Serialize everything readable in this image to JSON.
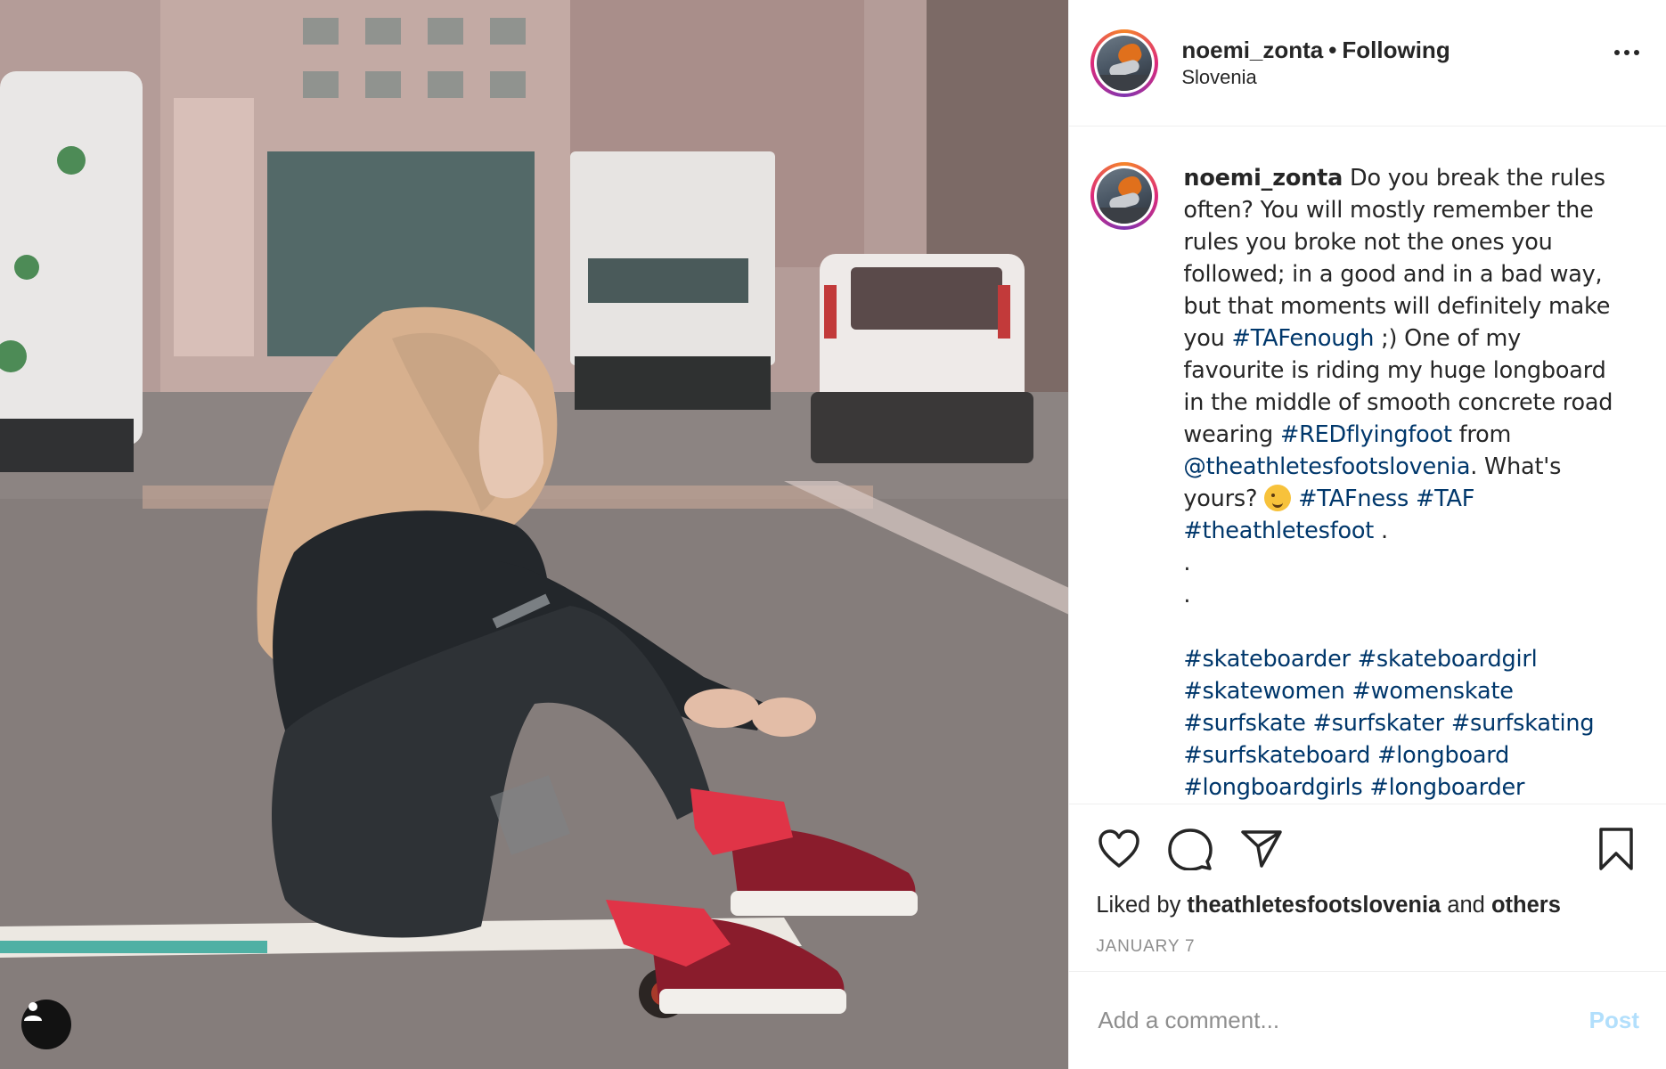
{
  "post": {
    "username": "noemi_zonta",
    "separator": "•",
    "follow_status": "Following",
    "location": "Slovenia"
  },
  "caption": {
    "username": "noemi_zonta",
    "t1": " Do you break the rules often? You will mostly remember the rules you broke not the ones you followed; in a good and in a bad way, but that moments will definitely make you ",
    "tag_tafenough": "#TAFenough",
    "t2": " ;) One of my favourite is riding my huge longboard in the middle of smooth concrete road wearing ",
    "tag_redflyingfoot": "#REDflyingfoot",
    "t3": " from ",
    "mention": "@theathletesfootslovenia",
    "t4": ". What's yours? ",
    "tag_tafness": "#TAFness",
    "tag_taf": "#TAF",
    "tag_theathletesfoot": "#theathletesfoot",
    "t5": " .",
    "dot1": ".",
    "dot2": ".",
    "hashtags_line1": "#skateboarder #skateboardgirl",
    "hashtags_line2": "#skatewomen #womenskate",
    "hashtags_line3": "#surfskate #surfskater #surfskating",
    "hashtags_line4": "#surfskateboard #longboard",
    "hashtags_line5": "#longboardgirls #longboarder"
  },
  "engagement": {
    "liked_prefix": "Liked by ",
    "liked_user": "theathletesfootslovenia",
    "liked_mid": " and ",
    "liked_others": "others",
    "date": "JANUARY 7"
  },
  "comment": {
    "placeholder": "Add a comment...",
    "post_label": "Post"
  },
  "icons": {
    "like": "heart-icon",
    "comment": "comment-bubble-icon",
    "share": "paper-plane-icon",
    "save": "bookmark-icon",
    "more": "more-options-icon",
    "user_tag": "user-tag-icon"
  },
  "colors": {
    "link": "#00376b",
    "post_button_disabled": "#b2dffc",
    "muted": "#8e8e8e"
  }
}
